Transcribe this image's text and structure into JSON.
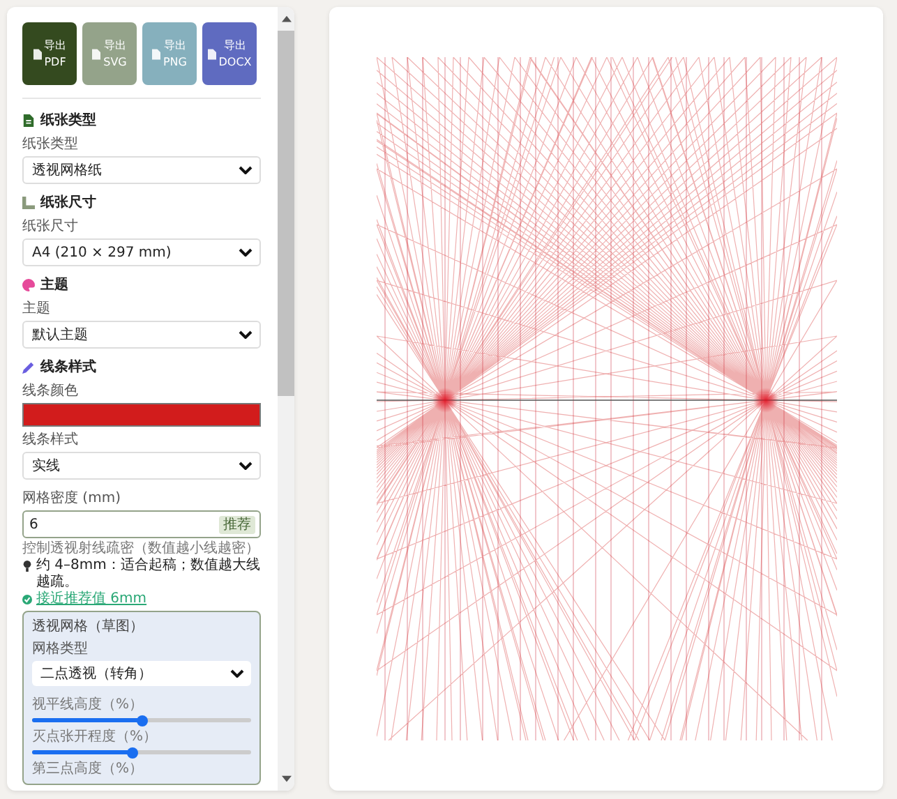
{
  "export_buttons": [
    {
      "label": "导出",
      "format": "PDF",
      "color": "#344a1f"
    },
    {
      "label": "导出",
      "format": "SVG",
      "color": "#94a38a"
    },
    {
      "label": "导出",
      "format": "PNG",
      "color": "#86b0bd"
    },
    {
      "label": "导出",
      "format": "DOCX",
      "color": "#5f6bc0"
    }
  ],
  "sections": [
    {
      "kind": "paper",
      "title": "纸张类型",
      "label": "纸张类型",
      "value": "透视网格纸"
    },
    {
      "kind": "size",
      "title": "纸张尺寸",
      "label": "纸张尺寸",
      "value": "A4 (210 × 297 mm)"
    },
    {
      "kind": "theme",
      "title": "主题",
      "label": "主题",
      "value": "默认主题"
    }
  ],
  "line_style": {
    "title": "线条样式",
    "color_label": "线条颜色",
    "color": "#d21c1c",
    "style_label": "线条样式",
    "style_value": "实线",
    "density_label": "网格密度 (mm)",
    "density_value": "6",
    "density_badge": "推荐",
    "density_help": "控制透视射线疏密（数值越小线越密）",
    "density_tip": "约 4–8mm：适合起稿；数值越大线越疏。",
    "density_ok": "接近推荐值 6mm"
  },
  "perspective": {
    "title": "透视网格（草图）",
    "type_label": "网格类型",
    "type_value": "二点透视（转角）",
    "sliders": [
      {
        "label": "视平线高度（%）",
        "level": 0.5
      },
      {
        "label": "灭点张开程度（%）",
        "level": 0.46
      }
    ],
    "cut_label": "第三点高度（%）"
  }
}
